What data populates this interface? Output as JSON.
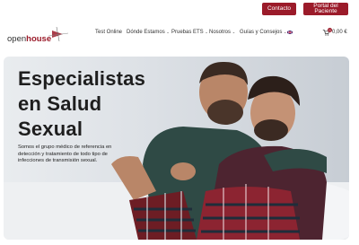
{
  "top_buttons": {
    "contact": "Contacto",
    "portal": "Portal del Paciente"
  },
  "logo": {
    "prefix": "open",
    "suffix": "house"
  },
  "nav": {
    "items": [
      "Test Online",
      "Dónde Estamos",
      "Pruebas ETS",
      "Nosotros",
      "Guías y Consejos"
    ],
    "cart_count": "0",
    "cart_total": "0,00 €"
  },
  "hero": {
    "title_line1": "Especialistas",
    "title_line2": "en Salud",
    "title_line3": "Sexual",
    "subtitle": "Somos el grupo médico de referencia en detección y tratamiento de todo tipo de infecciones de transmisión sexual."
  },
  "colors": {
    "brand": "#9b1b2a"
  }
}
